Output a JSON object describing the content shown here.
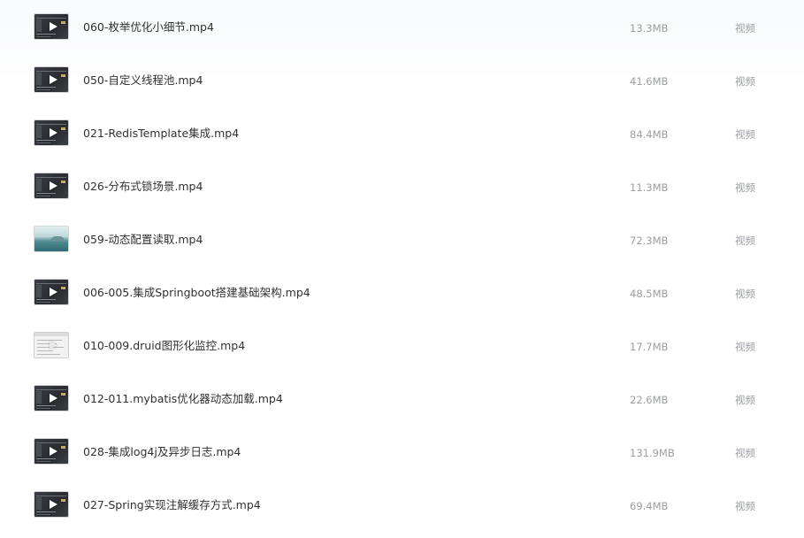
{
  "files": [
    {
      "name": "060-枚举优化小细节.mp4",
      "size": "13.3MB",
      "type": "视频",
      "thumbnail": "code-editor"
    },
    {
      "name": "050-自定义线程池.mp4",
      "size": "41.6MB",
      "type": "视频",
      "thumbnail": "code-editor"
    },
    {
      "name": "021-RedisTemplate集成.mp4",
      "size": "84.4MB",
      "type": "视频",
      "thumbnail": "code-editor"
    },
    {
      "name": "026-分布式锁场景.mp4",
      "size": "11.3MB",
      "type": "视频",
      "thumbnail": "code-editor"
    },
    {
      "name": "059-动态配置读取.mp4",
      "size": "72.3MB",
      "type": "视频",
      "thumbnail": "landscape"
    },
    {
      "name": "006-005.集成Springboot搭建基础架构.mp4",
      "size": "48.5MB",
      "type": "视频",
      "thumbnail": "code-editor"
    },
    {
      "name": "010-009.druid图形化监控.mp4",
      "size": "17.7MB",
      "type": "视频",
      "thumbnail": "web-page"
    },
    {
      "name": "012-011.mybatis优化器动态加载.mp4",
      "size": "22.6MB",
      "type": "视频",
      "thumbnail": "code-editor"
    },
    {
      "name": "028-集成log4j及异步日志.mp4",
      "size": "131.9MB",
      "type": "视频",
      "thumbnail": "code-editor"
    },
    {
      "name": "027-Spring实现注解缓存方式.mp4",
      "size": "69.4MB",
      "type": "视频",
      "thumbnail": "code-editor"
    }
  ],
  "icons": {
    "play": "play-icon"
  }
}
